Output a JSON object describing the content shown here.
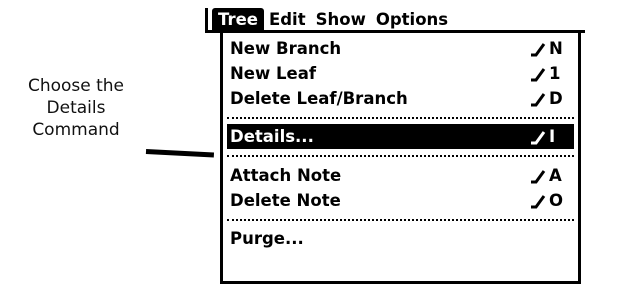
{
  "caption": {
    "line1": "Choose the",
    "line2": "Details",
    "line3": "Command"
  },
  "menubar": {
    "titles": [
      "Tree",
      "Edit",
      "Show",
      "Options"
    ],
    "active": "Tree"
  },
  "menu": {
    "items": [
      {
        "label": "New Branch",
        "shortcut": "N"
      },
      {
        "label": "New Leaf",
        "shortcut": "1"
      },
      {
        "label": "Delete Leaf/Branch",
        "shortcut": "D"
      },
      {
        "label": "Details...",
        "shortcut": "I",
        "selected": true
      },
      {
        "label": "Attach Note",
        "shortcut": "A"
      },
      {
        "label": "Delete Note",
        "shortcut": "O"
      },
      {
        "label": "Purge...",
        "shortcut": ""
      }
    ]
  },
  "icons": {
    "command_stroke": "command-stroke-icon"
  },
  "colors": {
    "foreground": "#000000",
    "background": "#ffffff",
    "highlight": "#000000",
    "highlight_text": "#ffffff"
  }
}
